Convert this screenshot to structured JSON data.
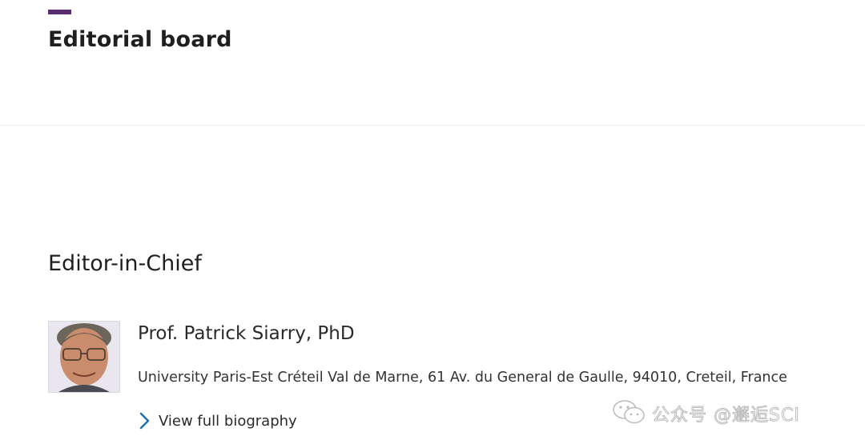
{
  "header": {
    "title": "Editorial board",
    "accent_color": "#5a2d6e"
  },
  "section": {
    "title": "Editor-in-Chief"
  },
  "editor": {
    "name": "Prof. Patrick Siarry, PhD",
    "affiliation": "University Paris-Est Créteil Val de Marne, 61 Av. du General de Gaulle, 94010, Creteil, France",
    "photo_icon": "person-photo",
    "link_label": "View full biography",
    "link_icon": "chevron-right-icon",
    "link_color": "#1f6fa8"
  },
  "watermark": {
    "icon": "wechat-icon",
    "text": "公众号 @邂逅SCI"
  }
}
